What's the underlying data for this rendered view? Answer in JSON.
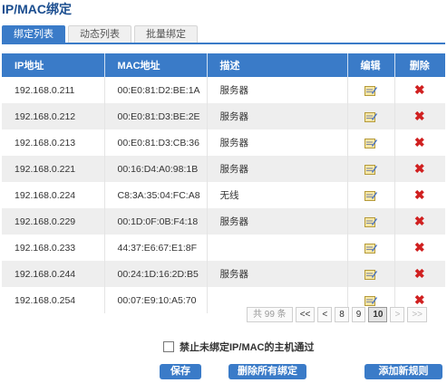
{
  "page": {
    "title": "IP/MAC绑定"
  },
  "tabs": [
    {
      "label": "绑定列表",
      "active": true
    },
    {
      "label": "动态列表",
      "active": false
    },
    {
      "label": "批量绑定",
      "active": false
    }
  ],
  "table": {
    "headers": {
      "ip": "IP地址",
      "mac": "MAC地址",
      "desc": "描述",
      "edit": "编辑",
      "delete": "删除"
    },
    "rows": [
      {
        "ip": "192.168.0.211",
        "mac": "00:E0:81:D2:BE:1A",
        "desc": "服务器"
      },
      {
        "ip": "192.168.0.212",
        "mac": "00:E0:81:D3:BE:2E",
        "desc": "服务器"
      },
      {
        "ip": "192.168.0.213",
        "mac": "00:E0:81:D3:CB:36",
        "desc": "服务器"
      },
      {
        "ip": "192.168.0.221",
        "mac": "00:16:D4:A0:98:1B",
        "desc": "服务器"
      },
      {
        "ip": "192.168.0.224",
        "mac": "C8:3A:35:04:FC:A8",
        "desc": "无线"
      },
      {
        "ip": "192.168.0.229",
        "mac": "00:1D:0F:0B:F4:18",
        "desc": "服务器"
      },
      {
        "ip": "192.168.0.233",
        "mac": "44:37:E6:67:E1:8F",
        "desc": ""
      },
      {
        "ip": "192.168.0.244",
        "mac": "00:24:1D:16:2D:B5",
        "desc": "服务器"
      },
      {
        "ip": "192.168.0.254",
        "mac": "00:07:E9:10:A5:70",
        "desc": ""
      }
    ]
  },
  "pagination": {
    "total": "共 99 条",
    "first": "<<",
    "prev": "<",
    "pages": [
      "8",
      "9",
      "10"
    ],
    "current": "10",
    "next": ">",
    "last": ">>"
  },
  "options": {
    "block_unbound_label": "禁止未绑定IP/MAC的主机通过",
    "block_unbound_checked": false
  },
  "actions": {
    "save": "保存",
    "delete_all": "删除所有绑定",
    "add_rule": "添加新规则"
  },
  "colors": {
    "accent": "#3a7bc8",
    "delete": "#d02020",
    "title": "#1a4d8f"
  }
}
